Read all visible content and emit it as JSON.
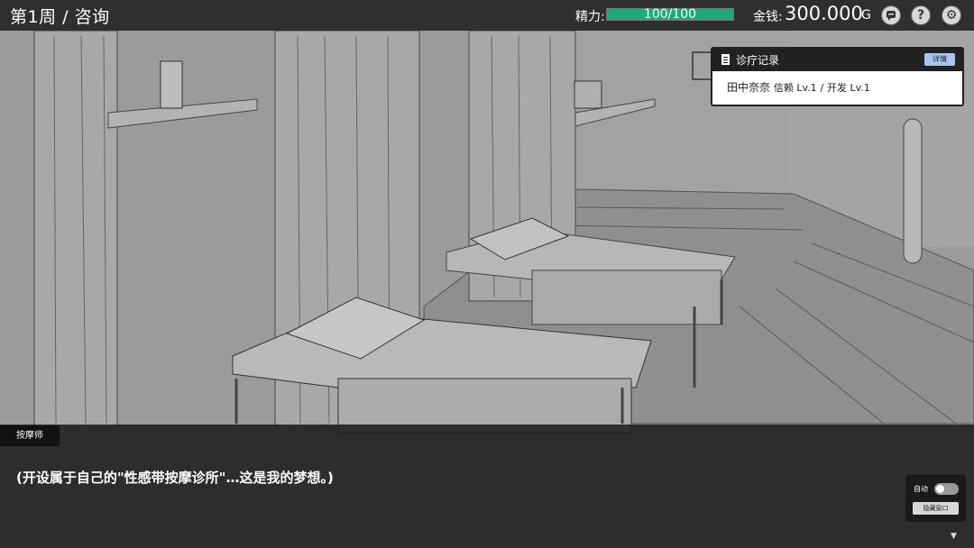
{
  "header": {
    "title": "第1周 / 咨询",
    "stamina_label": "精力:",
    "stamina_text": "100/100",
    "stamina_fraction": 1.0,
    "money_label": "金钱:",
    "money_value": "300.000",
    "money_unit": "G",
    "icons": [
      "chat-icon",
      "help-icon",
      "settings-icon"
    ],
    "accent_color": "#1fa878"
  },
  "record": {
    "title": "诊疗记录",
    "detail_label": "详情",
    "patient_name": "田中奈奈",
    "trust_label": "信赖 Lv.1",
    "separator": "/",
    "dev_label": "开发 Lv.1"
  },
  "dialogue": {
    "speaker": "按摩师",
    "text": "(开设属于自己的\"性感带按摩诊所\"…这是我的梦想。)",
    "auto_label": "自动",
    "auto_on": false,
    "hide_window_label": "隐藏窗口",
    "next_glyph": "▼"
  }
}
